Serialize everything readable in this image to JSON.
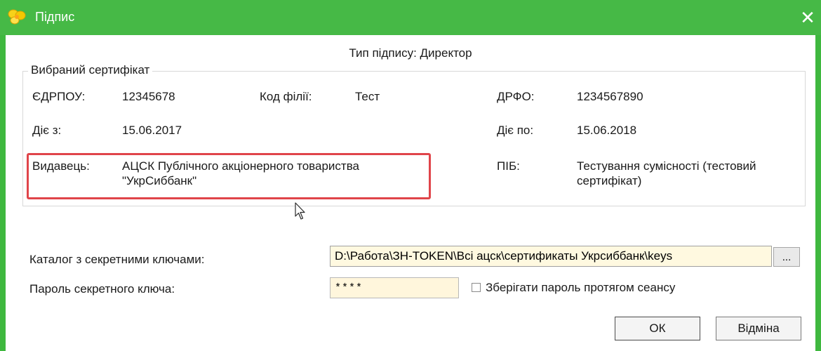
{
  "window": {
    "title": "Підпис",
    "close_glyph": "✕",
    "accent_color": "#46b946"
  },
  "signature_type": {
    "label": "Тип підпису:",
    "value": "Директор"
  },
  "certificate": {
    "legend": "Вибраний сертифікат",
    "edrpou_label": "ЄДРПОУ:",
    "edrpou_value": "12345678",
    "branch_label": "Код філії:",
    "branch_value": "Тест",
    "drfo_label": "ДРФО:",
    "drfo_value": "1234567890",
    "valid_from_label": "Діє з:",
    "valid_from_value": "15.06.2017",
    "valid_to_label": "Діє по:",
    "valid_to_value": "15.06.2018",
    "issuer_label": "Видавець:",
    "issuer_line1": "АЦСК Публічного акціонерного товариства",
    "issuer_line2": "\"УкрСиббанк\"",
    "name_label": "ПІБ:",
    "name_line1": "Тестування сумісності (тестовий",
    "name_line2": "сертифікат)",
    "highlight_color": "#e0454a"
  },
  "keys": {
    "catalog_label": "Каталог з секретними ключами:",
    "catalog_value": "D:\\Работа\\ЗН-TOKEN\\Всі ацск\\сертификаты Укрсиббанк\\keys",
    "browse_label": "...",
    "password_label": "Пароль секретного ключа:",
    "password_value": "****",
    "remember_label": "Зберігати пароль протягом сеансу",
    "remember_checked": false
  },
  "buttons": {
    "ok": "ОК",
    "cancel": "Відміна"
  },
  "icons": {
    "app": "yellow-flower-icon",
    "cursor": "mouse-pointer-icon"
  }
}
